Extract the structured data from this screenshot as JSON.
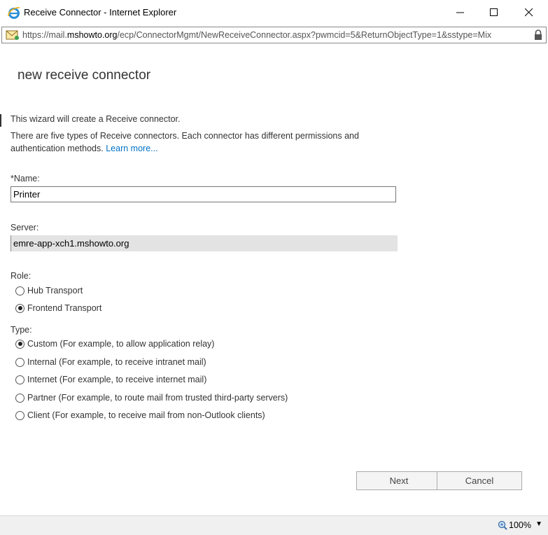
{
  "window": {
    "title": "Receive Connector - Internet Explorer",
    "icons": [
      "ie-logo-icon",
      "minimize-icon",
      "maximize-icon",
      "close-icon"
    ]
  },
  "address_bar": {
    "url_prefix": "https://mail.",
    "url_host": "mshowto.org",
    "url_rest": "/ecp/ConnectorMgmt/NewReceiveConnector.aspx?pwmcid=5&ReturnObjectType=1&sstype=Mix",
    "icons": [
      "page-mail-icon",
      "lock-icon"
    ]
  },
  "page": {
    "title": "new receive connector",
    "intro_line1": "This wizard will create a Receive connector.",
    "intro_line2": "There are five types of Receive connectors. Each connector has different permissions and authentication methods.",
    "learn_more": "Learn more..."
  },
  "form": {
    "name_label": "*Name:",
    "name_value": "Printer",
    "server_label": "Server:",
    "server_value": "emre-app-xch1.mshowto.org",
    "role_label": "Role:",
    "roles": [
      {
        "label": "Hub Transport",
        "checked": false
      },
      {
        "label": "Frontend Transport",
        "checked": true
      }
    ],
    "type_label": "Type:",
    "types": [
      {
        "label": "Custom (For example, to allow application relay)",
        "checked": true
      },
      {
        "label": "Internal (For example, to receive intranet mail)",
        "checked": false
      },
      {
        "label": "Internet (For example, to receive internet mail)",
        "checked": false
      },
      {
        "label": "Partner (For example, to route mail from trusted third-party servers)",
        "checked": false
      },
      {
        "label": "Client (For example, to receive mail from non-Outlook clients)",
        "checked": false
      }
    ]
  },
  "buttons": {
    "next": "Next",
    "cancel": "Cancel"
  },
  "status_bar": {
    "zoom": "100%",
    "zoom_caret": "▼",
    "icons": [
      "zoom-icon",
      "dropdown-caret-icon"
    ]
  }
}
